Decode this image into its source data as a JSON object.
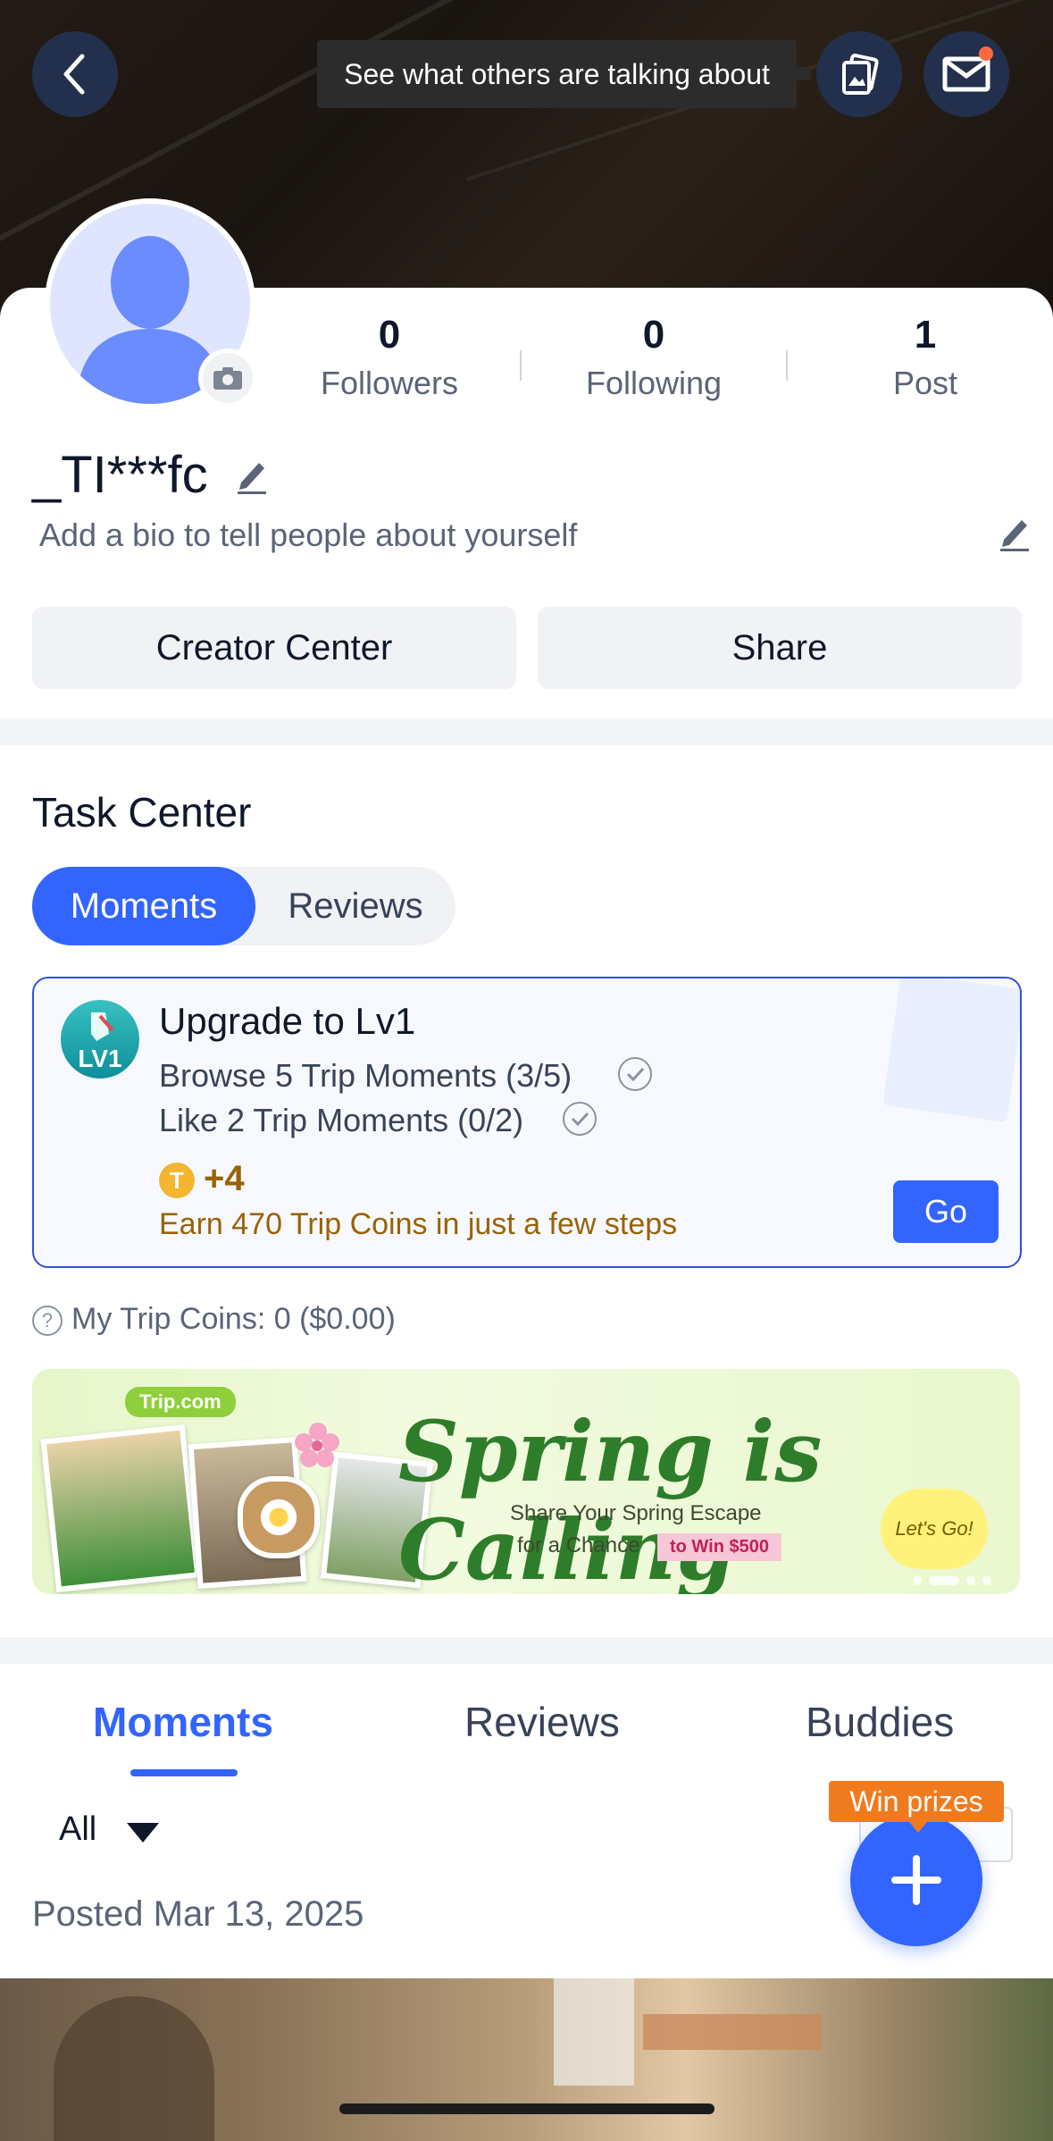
{
  "header": {
    "tooltip": "See what others are talking about",
    "icons": [
      "back-icon",
      "moments-icon",
      "mail-icon"
    ]
  },
  "profile": {
    "stats": [
      {
        "value": "0",
        "label": "Followers"
      },
      {
        "value": "0",
        "label": "Following"
      },
      {
        "value": "1",
        "label": "Post"
      }
    ],
    "username": "_TI***fc",
    "bio": "Add a bio to tell people about yourself",
    "buttons": {
      "creator": "Creator Center",
      "share": "Share"
    }
  },
  "task_center": {
    "title": "Task Center",
    "tabs": [
      "Moments",
      "Reviews"
    ],
    "selected_tab": "Moments",
    "task": {
      "badge": "LV1",
      "title": "Upgrade to Lv1",
      "lines": [
        "Browse 5 Trip Moments (3/5)",
        "Like 2 Trip Moments (0/2)"
      ],
      "coin_symbol": "T",
      "reward": "+4",
      "earn_text": "Earn 470 Trip Coins in just a few steps",
      "go_label": "Go"
    },
    "trip_coins": "My Trip Coins: 0 ($0.00)"
  },
  "banner": {
    "brand": "Trip.com",
    "headline": "Spring is Calling",
    "subline1": "Share Your Spring Escape",
    "subline2": "for a Chance",
    "win_tag": "to Win $500",
    "lets_go": "Let's Go!"
  },
  "feed": {
    "tabs": [
      "Moments",
      "Reviews",
      "Buddies"
    ],
    "selected_tab": "Moments",
    "filter": "All",
    "posted": "Posted Mar 13, 2025",
    "win_prizes": "Win prizes"
  },
  "colors": {
    "accent": "#3264ff",
    "gold": "#9a6206",
    "orange": "#f07b1e"
  }
}
